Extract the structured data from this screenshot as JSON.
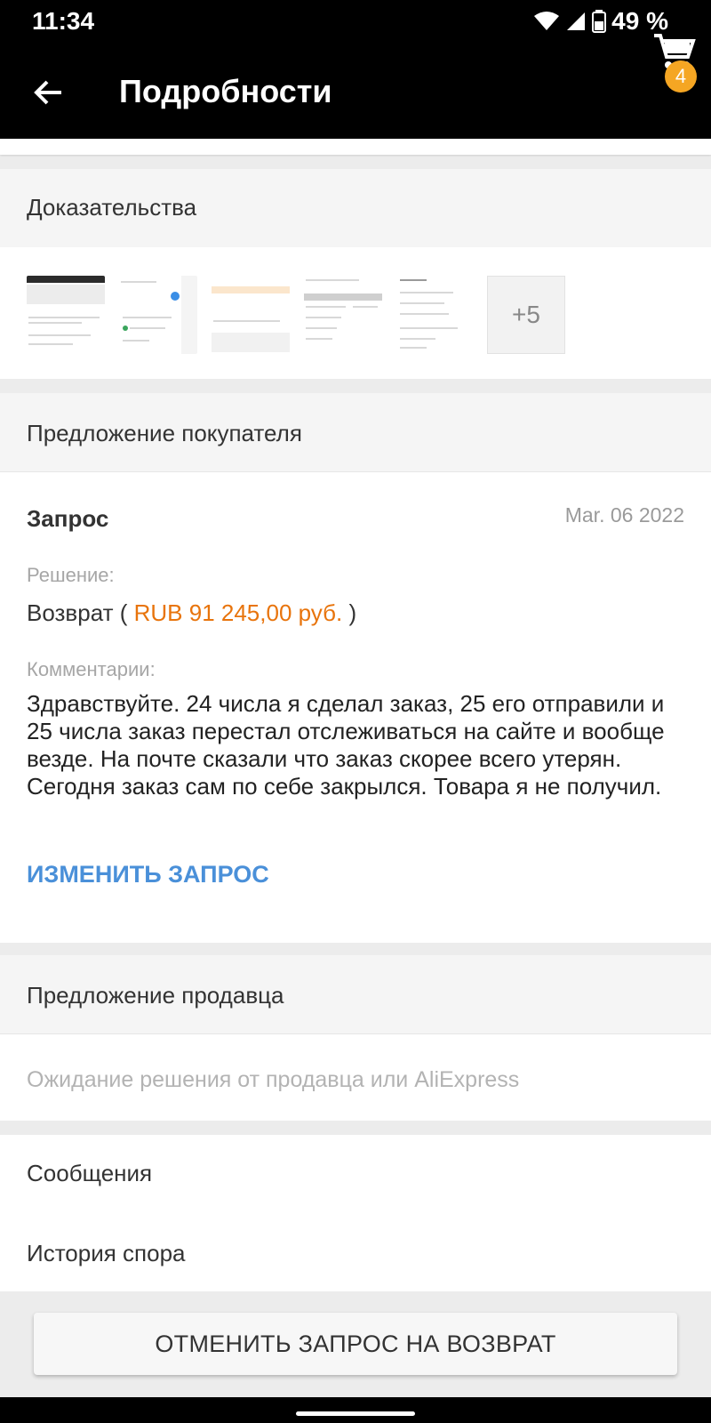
{
  "status_bar": {
    "time": "11:34",
    "battery": "49 %"
  },
  "header": {
    "title": "Подробности",
    "cart_count": "4"
  },
  "evidence": {
    "title": "Доказательства",
    "more_label": "+5"
  },
  "buyer_offer": {
    "title": "Предложение покупателя",
    "request_label": "Запрос",
    "date": "Mar. 06 2022",
    "decision_label": "Решение:",
    "decision_prefix": "Возврат (",
    "amount": "RUB 91 245,00 руб.",
    "decision_suffix": ")",
    "comments_label": "Комментарии:",
    "comment": "Здравствуйте. 24 числа я сделал заказ, 25 его отправили и 25 числа заказ перестал отслеживаться на сайте и вообще везде. На почте сказали что заказ скорее всего утерян. Сегодня заказ сам по себе закрылся. Товара я не получил.",
    "edit_label": "ИЗМЕНИТЬ ЗАПРОС"
  },
  "seller_offer": {
    "title": "Предложение продавца",
    "status": "Ожидание решения от продавца или AliExpress"
  },
  "links": {
    "messages": "Сообщения",
    "history": "История спора"
  },
  "cancel_button": "ОТМЕНИТЬ ЗАПРОС НА ВОЗВРАТ",
  "colors": {
    "accent_orange": "#e8740c",
    "link_blue": "#4a90d9",
    "badge": "#f5a623"
  }
}
